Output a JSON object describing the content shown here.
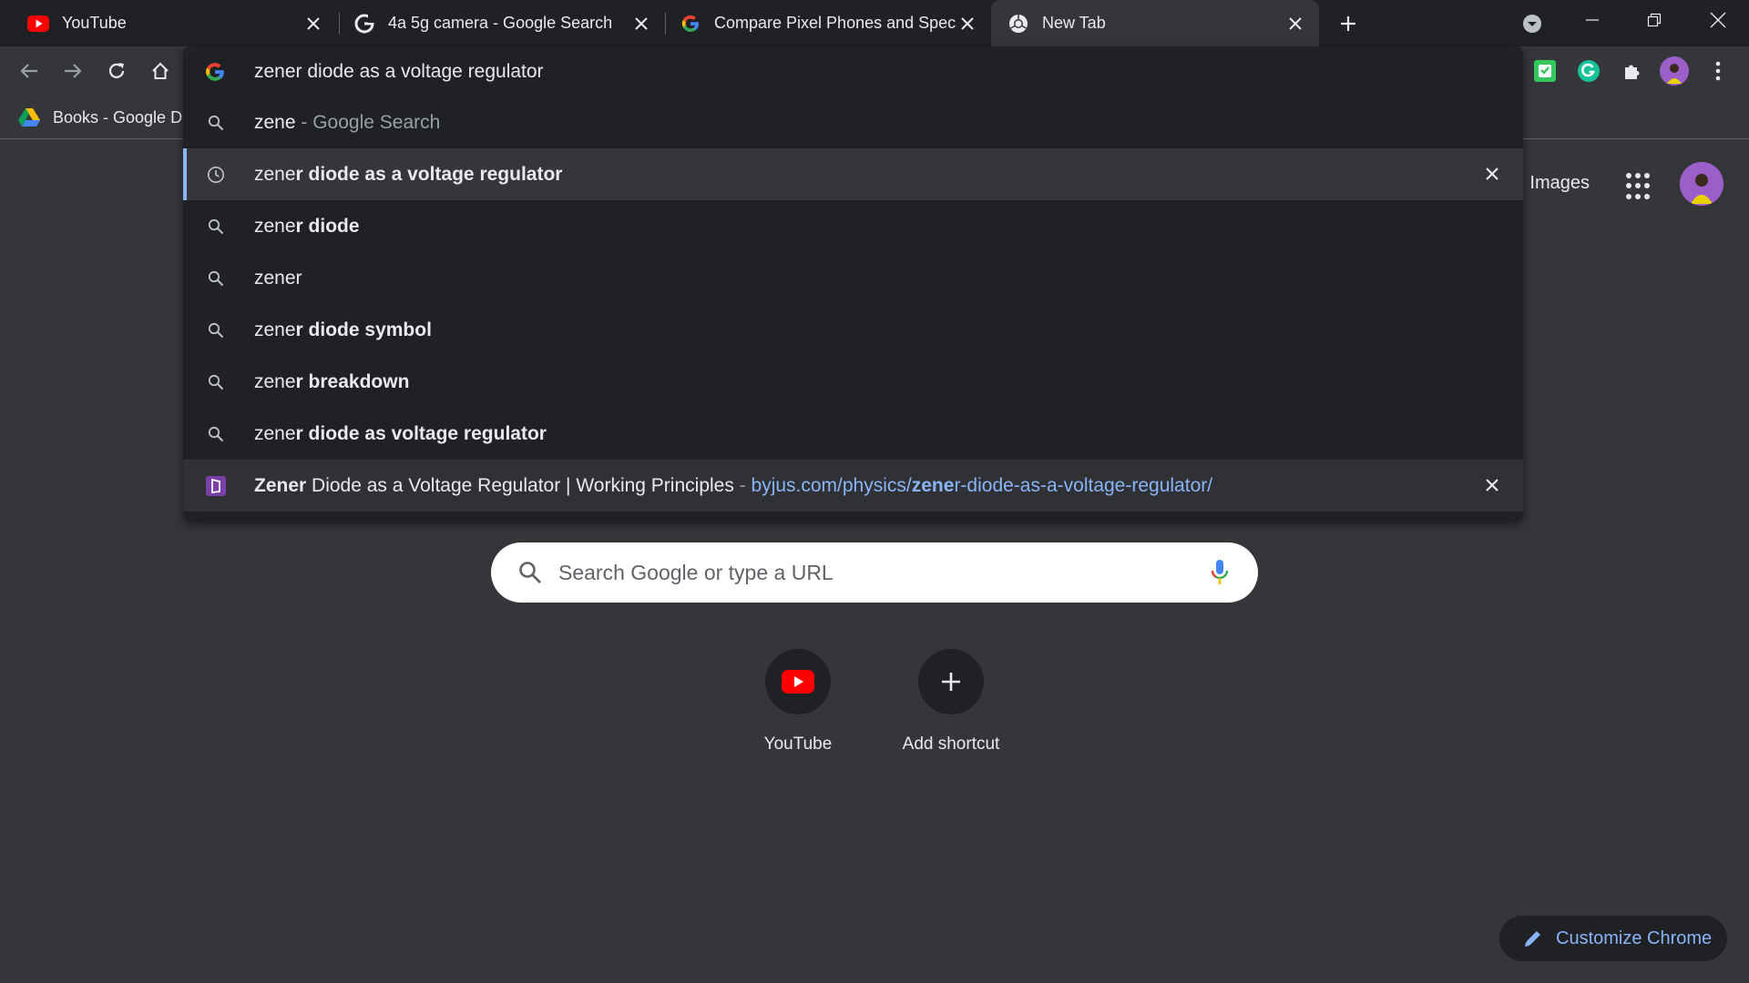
{
  "tabs": [
    {
      "title": "YouTube",
      "icon": "youtube-icon",
      "active": false
    },
    {
      "title": "4a 5g camera - Google Search",
      "icon": "google-icon",
      "active": false
    },
    {
      "title": "Compare Pixel Phones and Specs",
      "icon": "google-icon",
      "active": false
    },
    {
      "title": "New Tab",
      "icon": "chrome-icon",
      "active": true
    }
  ],
  "bookmarks": [
    {
      "title": "Books - Google Dr",
      "icon": "google-drive-icon"
    }
  ],
  "omnibox": {
    "input_value": "zener diode as a voltage regulator",
    "suggestions": [
      {
        "kind": "search",
        "typed": "zene",
        "rest": "",
        "suffix": " - Google Search",
        "icon": "search-icon"
      },
      {
        "kind": "history",
        "typed": "zene",
        "rest": "r diode as a voltage regulator",
        "suffix": "",
        "icon": "clock-icon",
        "selected": true,
        "removable": true
      },
      {
        "kind": "search",
        "typed": "zene",
        "rest": "r diode",
        "suffix": "",
        "icon": "search-icon"
      },
      {
        "kind": "search",
        "typed": "zener",
        "rest": "",
        "suffix": "",
        "icon": "search-icon"
      },
      {
        "kind": "search",
        "typed": "zene",
        "rest": "r diode symbol",
        "suffix": "",
        "icon": "search-icon"
      },
      {
        "kind": "search",
        "typed": "zene",
        "rest": "r breakdown",
        "suffix": "",
        "icon": "search-icon"
      },
      {
        "kind": "search",
        "typed": "zene",
        "rest": "r diode as voltage regulator",
        "suffix": "",
        "icon": "search-icon"
      }
    ],
    "site_suggestion": {
      "title_bold": "Zener",
      "title_rest": " Diode as a Voltage Regulator | Working Principles",
      "separator": " - ",
      "url_pre": "byjus.com/physics/",
      "url_bold": "zene",
      "url_post": "r-diode-as-a-voltage-regulator/",
      "icon": "byjus-icon"
    }
  },
  "ntp": {
    "images_link": "Images",
    "search_placeholder": "Search Google or type a URL",
    "shortcuts": [
      {
        "label": "YouTube",
        "icon": "youtube-icon"
      },
      {
        "label": "Add shortcut",
        "icon": "plus-icon"
      }
    ],
    "customize_label": "Customize Chrome"
  },
  "colors": {
    "background": "#35363a",
    "tabstrip": "#202124",
    "accent": "#8ab4f8",
    "youtube_red": "#ff0000"
  }
}
